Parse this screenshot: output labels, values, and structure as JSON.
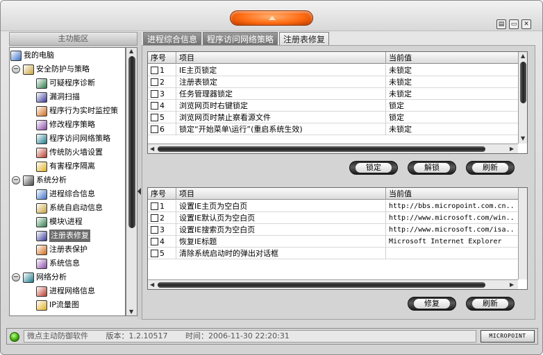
{
  "left_panel": {
    "header": "主功能区",
    "tree": [
      {
        "label": "我的电脑",
        "level": 0,
        "icon": "computer-icon"
      },
      {
        "label": "安全防护与策略",
        "level": 1,
        "icon": "security-folder-icon",
        "expander": "−"
      },
      {
        "label": "可疑程序诊断",
        "level": 2,
        "icon": "diagnose-icon"
      },
      {
        "label": "漏洞扫描",
        "level": 2,
        "icon": "magnifier-icon"
      },
      {
        "label": "程序行为实时监控策",
        "level": 2,
        "icon": "monitor-icon"
      },
      {
        "label": "修改程序策略",
        "level": 2,
        "icon": "edit-policy-icon"
      },
      {
        "label": "程序访问网络策略",
        "level": 2,
        "icon": "network-policy-icon"
      },
      {
        "label": "传统防火墙设置",
        "level": 2,
        "icon": "firewall-icon"
      },
      {
        "label": "有害程序隔离",
        "level": 2,
        "icon": "quarantine-icon"
      },
      {
        "label": "系统分析",
        "level": 1,
        "icon": "system-analysis-icon",
        "expander": "−"
      },
      {
        "label": "进程综合信息",
        "level": 2,
        "icon": "process-info-icon"
      },
      {
        "label": "系统自启动信息",
        "level": 2,
        "icon": "autostart-icon"
      },
      {
        "label": "模块\\进程",
        "level": 2,
        "icon": "module-icon"
      },
      {
        "label": "注册表修复",
        "level": 2,
        "icon": "registry-repair-icon",
        "selected": true
      },
      {
        "label": "注册表保护",
        "level": 2,
        "icon": "registry-protect-icon"
      },
      {
        "label": "系统信息",
        "level": 2,
        "icon": "system-info-icon"
      },
      {
        "label": "网络分析",
        "level": 1,
        "icon": "network-analysis-icon",
        "expander": "−"
      },
      {
        "label": "进程网络信息",
        "level": 2,
        "icon": "process-network-icon"
      },
      {
        "label": "IP流量图",
        "level": 2,
        "icon": "traffic-chart-icon"
      }
    ]
  },
  "tabs": [
    {
      "label": "进程综合信息",
      "active": false
    },
    {
      "label": "程序访问网络策略",
      "active": false
    },
    {
      "label": "注册表修复",
      "active": true
    }
  ],
  "table_top": {
    "headers": [
      "序号",
      "项目",
      "当前值"
    ],
    "rows": [
      {
        "no": "1",
        "item": "IE主页锁定",
        "value": "未锁定"
      },
      {
        "no": "2",
        "item": "注册表锁定",
        "value": "未锁定"
      },
      {
        "no": "3",
        "item": "任务管理器锁定",
        "value": "未锁定"
      },
      {
        "no": "4",
        "item": "浏览网页时右键锁定",
        "value": "锁定"
      },
      {
        "no": "5",
        "item": "浏览网页时禁止察看源文件",
        "value": "锁定"
      },
      {
        "no": "6",
        "item": "锁定“开始菜单\\运行”(重启系统生效)",
        "value": "未锁定"
      }
    ]
  },
  "buttons_top": {
    "lock": "锁定",
    "unlock": "解锁",
    "refresh": "刷新"
  },
  "table_bottom": {
    "headers": [
      "序号",
      "项目",
      "当前值"
    ],
    "rows": [
      {
        "no": "1",
        "item": "设置IE主页为空白页",
        "value": "http://bbs.micropoint.com.cn.."
      },
      {
        "no": "2",
        "item": "设置IE默认页为空白页",
        "value": "http://www.microsoft.com/win.."
      },
      {
        "no": "3",
        "item": "设置IE搜索页为空白页",
        "value": "http://www.microsoft.com/isa.."
      },
      {
        "no": "4",
        "item": "恢复IE标题",
        "value": "Microsoft Internet Explorer"
      },
      {
        "no": "5",
        "item": "清除系统启动时的弹出对话框",
        "value": ""
      }
    ]
  },
  "buttons_bottom": {
    "repair": "修复",
    "refresh": "刷新"
  },
  "status": {
    "app_name": "微点主动防御软件",
    "version": "版本：1.2.10517",
    "time": "时间：2006-11-30 22:20:31",
    "brand": "MICROPOINT"
  }
}
